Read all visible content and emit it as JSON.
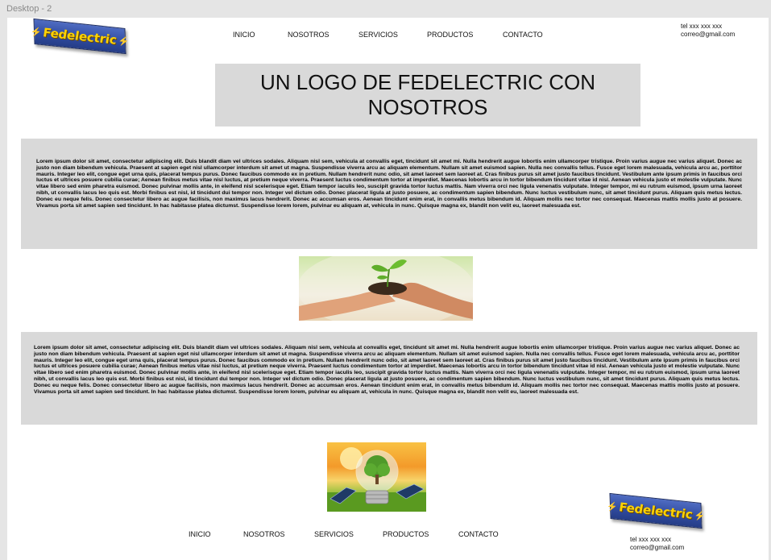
{
  "frame": {
    "label": "Desktop - 2"
  },
  "brand": {
    "name": "Fedelectric"
  },
  "nav": {
    "items": [
      "INICIO",
      "NOSOTROS",
      "SERVICIOS",
      "PRODUCTOS",
      "CONTACTO"
    ]
  },
  "contact": {
    "phone": "tel xxx xxx xxx",
    "email": "correo@gmail.com"
  },
  "hero": {
    "title": "UN LOGO DE FEDELECTRIC CON NOSOTROS"
  },
  "content": {
    "paragraph_1": "Lorem ipsum dolor sit amet, consectetur adipiscing elit. Duis blandit diam vel ultrices sodales. Aliquam nisl sem, vehicula at convallis eget, tincidunt sit amet mi. Nulla hendrerit augue lobortis enim ullamcorper tristique. Proin varius augue nec varius aliquet. Donec ac justo non diam bibendum vehicula. Praesent at sapien eget nisl ullamcorper interdum sit amet ut magna. Suspendisse viverra arcu ac aliquam elementum. Nullam sit amet euismod sapien. Nulla nec convallis tellus. Fusce eget lorem malesuada, vehicula arcu ac, porttitor mauris. Integer leo elit, congue eget urna quis, placerat tempus purus. Donec faucibus commodo ex in pretium. Nullam hendrerit nunc odio, sit amet laoreet sem laoreet at. Cras finibus purus sit amet justo faucibus tincidunt. Vestibulum ante ipsum primis in faucibus orci luctus et ultrices posuere cubilia curae; Aenean finibus metus vitae nisl luctus, at pretium neque viverra. Praesent luctus condimentum tortor at imperdiet. Maecenas lobortis arcu in tortor bibendum tincidunt vitae id nisl. Aenean vehicula justo et molestie vulputate. Nunc vitae libero sed enim pharetra euismod. Donec pulvinar mollis ante, in eleifend nisl scelerisque eget. Etiam tempor iaculis leo, suscipit gravida tortor luctus mattis. Nam viverra orci nec ligula venenatis vulputate. Integer tempor, mi eu rutrum euismod, ipsum urna laoreet nibh, ut convallis lacus leo quis est. Morbi finibus est nisl, id tincidunt dui tempor non. Integer vel dictum odio. Donec placerat ligula at justo posuere, ac condimentum sapien bibendum. Nunc luctus vestibulum nunc, sit amet tincidunt purus. Aliquam quis metus lectus. Donec eu neque felis. Donec consectetur libero ac augue facilisis, non maximus lacus hendrerit. Donec ac accumsan eros. Aenean tincidunt enim erat, in convallis metus bibendum id. Aliquam mollis nec tortor nec consequat. Maecenas mattis mollis justo at posuere. Vivamus porta sit amet sapien sed tincidunt. In hac habitasse platea dictumst. Suspendisse lorem lorem, pulvinar eu aliquam at, vehicula in nunc. Quisque magna ex, blandit non velit eu, laoreet malesuada est.",
    "paragraph_2": "Lorem ipsum dolor sit amet, consectetur adipiscing elit. Duis blandit diam vel ultrices sodales. Aliquam nisl sem, vehicula at convallis eget, tincidunt sit amet mi. Nulla hendrerit augue lobortis enim ullamcorper tristique. Proin varius augue nec varius aliquet. Donec ac justo non diam bibendum vehicula. Praesent at sapien eget nisl ullamcorper interdum sit amet ut magna. Suspendisse viverra arcu ac aliquam elementum. Nullam sit amet euismod sapien. Nulla nec convallis tellus. Fusce eget lorem malesuada, vehicula arcu ac, porttitor mauris. Integer leo elit, congue eget urna quis, placerat tempus purus. Donec faucibus commodo ex in pretium. Nullam hendrerit nunc odio, sit amet laoreet sem laoreet at. Cras finibus purus sit amet justo faucibus tincidunt. Vestibulum ante ipsum primis in faucibus orci luctus et ultrices posuere cubilia curae; Aenean finibus metus vitae nisl luctus, at pretium neque viverra. Praesent luctus condimentum tortor at imperdiet. Maecenas lobortis arcu in tortor bibendum tincidunt vitae id nisl. Aenean vehicula justo et molestie vulputate. Nunc vitae libero sed enim pharetra euismod. Donec pulvinar mollis ante, in eleifend nisl scelerisque eget. Etiam tempor iaculis leo, suscipit gravida tortor luctus mattis. Nam viverra orci nec ligula venenatis vulputate. Integer tempor, mi eu rutrum euismod, ipsum urna laoreet nibh, ut convallis lacus leo quis est. Morbi finibus est nisl, id tincidunt dui tempor non. Integer vel dictum odio. Donec placerat ligula at justo posuere, ac condimentum sapien bibendum. Nunc luctus vestibulum nunc, sit amet tincidunt purus. Aliquam quis metus lectus. Donec eu neque felis. Donec consectetur libero ac augue facilisis, non maximus lacus hendrerit. Donec ac accumsan eros. Aenean tincidunt enim erat, in convallis metus bibendum id. Aliquam mollis nec tortor nec consequat. Maecenas mattis mollis justo at posuere. Vivamus porta sit amet sapien sed tincidunt. In hac habitasse platea dictumst. Suspendisse lorem lorem, pulvinar eu aliquam at, vehicula in nunc. Quisque magna ex, blandit non velit eu, laoreet malesuada est."
  },
  "images": {
    "hands": "hands-holding-seedling-image",
    "bulb": "lightbulb-with-tree-image"
  },
  "colors": {
    "logo_blue": "#2f4a9e",
    "logo_yellow": "#ffd200",
    "block_gray": "#d9d9d9",
    "canvas": "#e5e5e5"
  }
}
